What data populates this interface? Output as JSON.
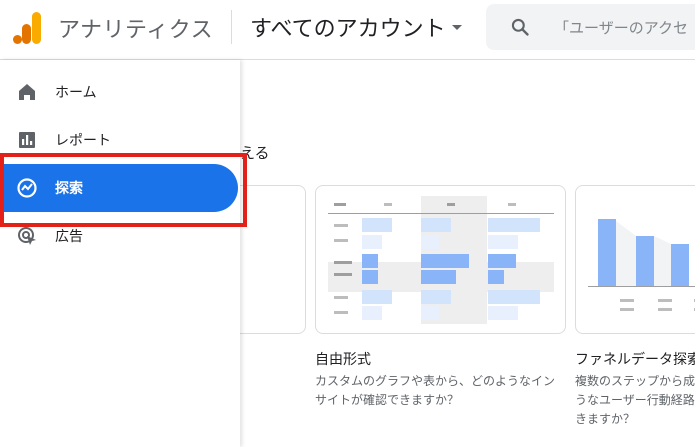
{
  "header": {
    "app_name": "アナリティクス",
    "account_label": "すべてのアカウント",
    "search_placeholder": "「ユーザーのアクセ"
  },
  "sidebar": {
    "items": [
      {
        "label": "ホーム",
        "icon": "home-icon",
        "active": false
      },
      {
        "label": "レポート",
        "icon": "reports-icon",
        "active": false
      },
      {
        "label": "探索",
        "icon": "explore-icon",
        "active": true
      },
      {
        "label": "広告",
        "icon": "advertising-icon",
        "active": false
      }
    ]
  },
  "main": {
    "section_title_fragment": "える",
    "cards": [
      {
        "title": "自由形式",
        "description": [
          "カスタムのグラフや表から、どのようなイン",
          "サイトが確認できますか？"
        ]
      },
      {
        "title": "ファネルデータ探索",
        "description": [
          "複数のステップから成",
          "うなユーザー行動経路",
          "きますか？"
        ]
      }
    ]
  },
  "colors": {
    "accent": "#1a73e8",
    "highlight": "#e32119",
    "logo_orange": "#f9ab00",
    "logo_dark_orange": "#e37400",
    "chart_blue": "#8ab4f8",
    "chart_light_blue": "#d2e3fc"
  }
}
